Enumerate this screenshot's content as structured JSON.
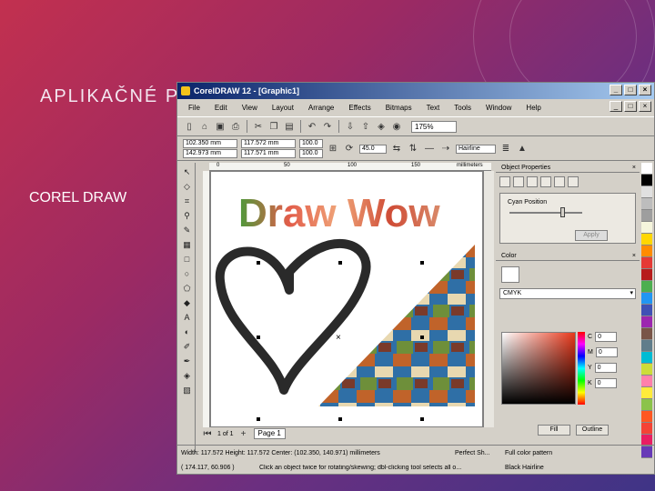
{
  "slide": {
    "title": "APLIKAČNÉ P",
    "subtitle": "COREL DRAW"
  },
  "window": {
    "title": "CorelDRAW 12 - [Graphic1]",
    "controls": [
      "_",
      "□",
      "×"
    ],
    "menu": [
      "File",
      "Edit",
      "View",
      "Layout",
      "Arrange",
      "Effects",
      "Bitmaps",
      "Text",
      "Tools",
      "Window",
      "Help"
    ],
    "zoom": "175%",
    "props": {
      "x": "102.350 mm",
      "y": "142.973 mm",
      "w": "117.572 mm",
      "h": "117.571 mm",
      "sx": "100.0",
      "sy": "100.0",
      "angle": "45.0",
      "outline": "Hairline"
    },
    "ruler_units": "millimeters",
    "ruler_ticks": [
      "0",
      "50",
      "100",
      "150"
    ],
    "canvas_text": "Draw Wow",
    "page": {
      "count": "1 of 1",
      "tab": "Page 1"
    }
  },
  "docker": {
    "header": "Object Properties",
    "option": "Cyan Position",
    "apply": "Apply",
    "color_header": "Color",
    "model": "CMYK",
    "cmyk": [
      {
        "k": "C",
        "v": "0"
      },
      {
        "k": "M",
        "v": "0"
      },
      {
        "k": "Y",
        "v": "0"
      },
      {
        "k": "K",
        "v": "0"
      }
    ],
    "buttons": [
      "Fill",
      "Outline"
    ]
  },
  "palette": [
    "#ffffff",
    "#000000",
    "#e0e0e0",
    "#bdbdbd",
    "#9e9e9e",
    "#f5f5dc",
    "#ffd700",
    "#ff8c00",
    "#e53935",
    "#b71c1c",
    "#4caf50",
    "#2196f3",
    "#3f51b5",
    "#9c27b0",
    "#795548",
    "#607d8b",
    "#00bcd4",
    "#cddc39",
    "#ff80ab",
    "#ffeb3b",
    "#8bc34a",
    "#ff5722",
    "#f44336",
    "#e91e63",
    "#673ab7"
  ],
  "status": {
    "line1_left": "Width: 117.572  Height: 117.572  Center: (102.350, 140.971) millimeters",
    "line1_right_a": "Perfect Sh...",
    "line1_right_b": "Full color pattern",
    "line2_left": "( 174.117, 60.906 )",
    "line2_mid": "Click an object twice for rotating/skewing; dbl-clicking tool selects all o...",
    "line2_right": "Black Hairline"
  }
}
